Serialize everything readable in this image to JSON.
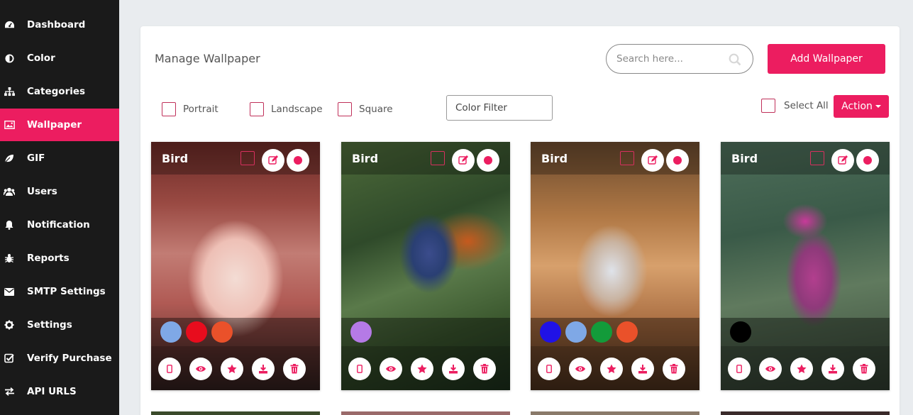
{
  "sidebar": {
    "items": [
      {
        "label": "Dashboard",
        "icon": "dashboard-icon",
        "active": false
      },
      {
        "label": "Color",
        "icon": "color-icon",
        "active": false
      },
      {
        "label": "Categories",
        "icon": "sitemap-icon",
        "active": false
      },
      {
        "label": "Wallpaper",
        "icon": "image-icon",
        "active": true
      },
      {
        "label": "GIF",
        "icon": "leaf-icon",
        "active": false
      },
      {
        "label": "Users",
        "icon": "users-icon",
        "active": false
      },
      {
        "label": "Notification",
        "icon": "bell-icon",
        "active": false
      },
      {
        "label": "Reports",
        "icon": "bug-icon",
        "active": false
      },
      {
        "label": "SMTP Settings",
        "icon": "envelope-icon",
        "active": false
      },
      {
        "label": "Settings",
        "icon": "gear-icon",
        "active": false
      },
      {
        "label": "Verify Purchase",
        "icon": "check-square-icon",
        "active": false
      },
      {
        "label": "API URLS",
        "icon": "exchange-icon",
        "active": false
      }
    ]
  },
  "header": {
    "title": "Manage Wallpaper",
    "search_placeholder": "Search here...",
    "add_label": "Add Wallpaper"
  },
  "filters": {
    "portrait": "Portrait",
    "landscape": "Landscape",
    "square": "Square",
    "color_filter": "Color Filter",
    "select_all": "Select All",
    "action": "Action"
  },
  "colors": {
    "accent": "#ec1d60",
    "sidebar_bg": "#1a1a1a"
  },
  "cards": [
    {
      "title": "Bird",
      "swatches": [
        "#7fa8e6",
        "#e80c1d",
        "#ea512a"
      ]
    },
    {
      "title": "Bird",
      "swatches": [
        "#b57ae6"
      ]
    },
    {
      "title": "Bird",
      "swatches": [
        "#2012e6",
        "#7fa8e6",
        "#139b3a",
        "#ea512a"
      ]
    },
    {
      "title": "Bird",
      "swatches": [
        "#000000"
      ]
    }
  ]
}
